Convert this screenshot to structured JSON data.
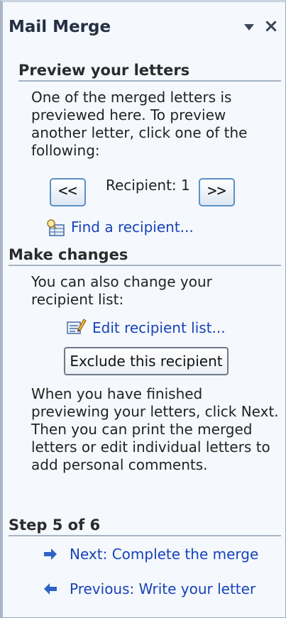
{
  "pane": {
    "title": "Mail Merge"
  },
  "preview": {
    "heading": "Preview your letters",
    "description": "One of the merged letters is previewed here. To preview another letter, click one of the following:",
    "prev_label": "<<",
    "next_label": ">>",
    "recipient_label": "Recipient: 1",
    "find_label": "Find a recipient..."
  },
  "changes": {
    "heading": "Make changes",
    "description": "You can also change your recipient list:",
    "edit_label": "Edit recipient list...",
    "exclude_label": "Exclude this recipient",
    "finish_text": "When you have finished previewing your letters, click Next. Then you can print the merged letters or edit individual letters to add personal comments."
  },
  "step": {
    "heading": "Step 5 of 6",
    "next_label": "Next: Complete the merge",
    "previous_label": "Previous: Write your letter"
  },
  "colors": {
    "link": "#1643b8",
    "nav_border": "#5b8fc9"
  }
}
